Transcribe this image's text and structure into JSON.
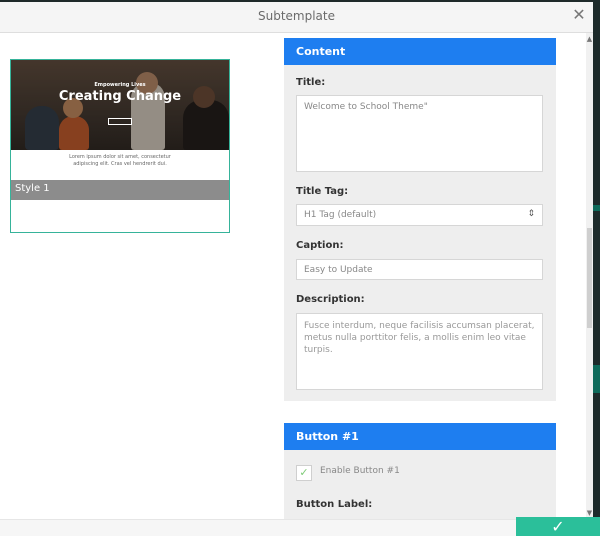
{
  "header": {
    "title": "Subtemplate"
  },
  "preview": {
    "hero_small": "Empowering Lives",
    "hero_title": "Creating Change",
    "body_line1": "Lorem ipsum dolor sit amet, consectetur",
    "body_line2": "adipiscing elit. Cras vel hendrerit dui.",
    "style_label": "Style 1"
  },
  "content": {
    "header": "Content",
    "title_label": "Title:",
    "title_value": "Welcome to School Theme\"",
    "title_tag_label": "Title Tag:",
    "title_tag_value": "H1 Tag (default)",
    "caption_label": "Caption:",
    "caption_value": "Easy to Update",
    "description_label": "Description:",
    "description_value": "Fusce interdum, neque facilisis accumsan placerat, metus nulla porttitor felis, a mollis enim leo vitae turpis."
  },
  "button1": {
    "header": "Button #1",
    "enable_label": "Enable Button #1",
    "enable_checked": true,
    "button_label_label": "Button Label:"
  },
  "icons": {
    "close": "close-icon",
    "chevron": "chevron-up-down-icon",
    "check": "check-icon",
    "confirm": "check-icon"
  },
  "colors": {
    "accent": "#1e7ef0",
    "confirm": "#2bbf9a",
    "thumb_border": "#36b39a"
  }
}
